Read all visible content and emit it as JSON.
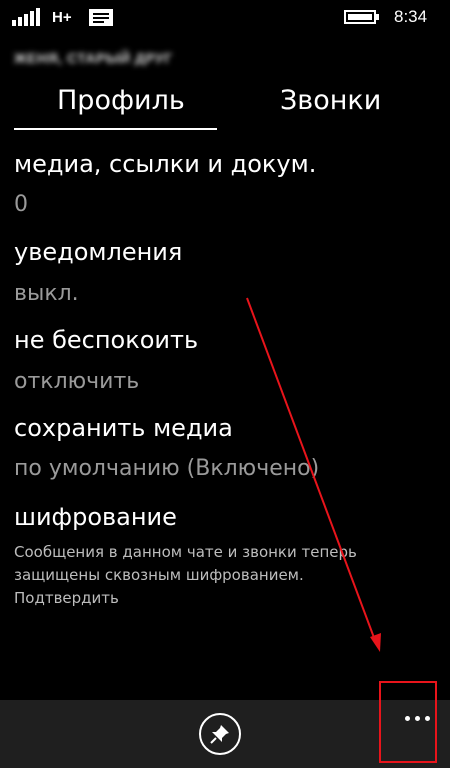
{
  "status_bar": {
    "network": "H+",
    "time": "8:34",
    "icons": [
      "signal-icon",
      "message-icon",
      "battery-icon"
    ]
  },
  "header": {
    "contact_name": "ЖЕНЯ, СТАРЫЙ ДРУГ"
  },
  "tabs": [
    {
      "label": "Профиль",
      "active": true
    },
    {
      "label": "Звонки",
      "active": false
    }
  ],
  "settings": {
    "media": {
      "title": "медиа, ссылки и докум.",
      "value": "0"
    },
    "notifications": {
      "title": "уведомления",
      "value": "выкл."
    },
    "do_not_disturb": {
      "title": "не беспокоить",
      "value": "отключить"
    },
    "save_media": {
      "title": "сохранить медиа",
      "value": "по умолчанию (Включено)"
    },
    "encryption": {
      "title": "шифрование",
      "description": "Сообщения в данном чате и звонки теперь защищены сквозным шифрованием. Подтвердить"
    }
  },
  "app_bar": {
    "icons": [
      "pin-icon",
      "more-icon"
    ]
  },
  "colors": {
    "background": "#000000",
    "app_bar": "#1f1f1f",
    "secondary_text": "#9a9a9a",
    "annotation": "#e8141b"
  }
}
